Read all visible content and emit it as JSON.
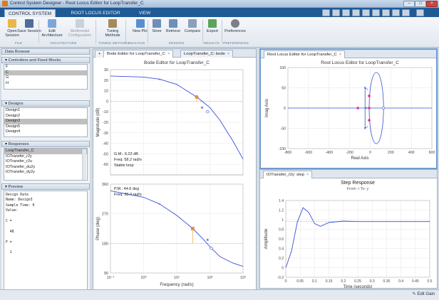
{
  "window": {
    "title": "Control System Designer - Root Locus Editor for LoopTransfer_C"
  },
  "tabs": [
    "CONTROL SYSTEM",
    "ROOT LOCUS EDITOR",
    "VIEW"
  ],
  "ribbon": {
    "buttons": [
      "Open Session",
      "Save Session",
      "Edit Architecture",
      "Multimodel Configuration",
      "Tuning Methods",
      "New Plot",
      "Store",
      "Retrieve",
      "Compare",
      "Export",
      "Preferences"
    ],
    "sections": [
      "FILE",
      "ARCHITECTURE",
      "TUNING METHODS",
      "ANALYSIS",
      "DESIGNS",
      "RESULTS",
      "PREFERENCES"
    ]
  },
  "data_browser": {
    "title": "Data Browser",
    "controllers_title": "Controllers and Fixed Blocks",
    "controllers": [
      "F",
      "C",
      "G",
      "H"
    ],
    "controllers_selected": 1,
    "designs_title": "Designs",
    "designs": [
      "Design1",
      "Design2",
      "Design3",
      "Design5",
      "Design4"
    ],
    "designs_selected": 2,
    "responses_title": "Responses",
    "responses": [
      "LoopTransfer_C",
      "IOTransfer_r2y",
      "IOTransfer_r2u",
      "IOTransfer_du2y",
      "IOTransfer_dy2y"
    ],
    "responses_selected": 0,
    "preview_title": "Preview",
    "preview_text": "Design Data\nName: Design3\nSample Time: 0\nValue:\n\nC =\n\n  48\n\nF =\n\n  1"
  },
  "bode_tabs": [
    "Bode Editor for LoopTransfer_C",
    "LoopTransfer_C: bode"
  ],
  "rl_tabs": [
    "Root Locus Editor for LoopTransfer_C"
  ],
  "step_tabs": [
    "IOTransfer_r2y: step"
  ],
  "status": {
    "edit_gain": "Edit Gain"
  },
  "chart_data": [
    {
      "type": "line",
      "title": "Bode Editor for LoopTransfer_C",
      "ylabel": "Magnitude (dB)",
      "xscale": "log",
      "xlim": [
        0.1,
        1000
      ],
      "ylim": [
        -70,
        30
      ],
      "x": [
        0.1,
        1,
        3,
        10,
        20,
        40,
        58.2,
        100,
        200,
        500,
        1000
      ],
      "y": [
        24,
        23,
        21,
        16,
        10,
        4,
        0,
        -6,
        -18,
        -38,
        -55
      ],
      "annotations": [
        "G.M.: 6.22 dB",
        "Freq: 58.2 rad/s",
        "Stable loop"
      ],
      "grid": true
    },
    {
      "type": "line",
      "ylabel": "Phase (deg)",
      "xlabel": "Frequency (rad/s)",
      "xscale": "log",
      "xlim": [
        0.1,
        1000
      ],
      "ylim": [
        90,
        360
      ],
      "x": [
        0.1,
        1,
        3,
        10,
        30.4,
        60,
        100,
        200,
        500,
        1000
      ],
      "y": [
        340,
        320,
        300,
        265,
        225,
        195,
        170,
        140,
        120,
        110
      ],
      "annotations": [
        "P.M.: 44.6 deg",
        "Freq: 30.4 rad/s"
      ],
      "grid": true
    },
    {
      "type": "scatter",
      "title": "Root Locus Editor for LoopTransfer_C",
      "xlabel": "Real Axis",
      "ylabel": "Imag Axis",
      "xlim": [
        -800,
        600
      ],
      "ylim": [
        -100,
        100
      ],
      "grid": true
    },
    {
      "type": "line",
      "title": "Step Response",
      "subtitle": "From: r  To: y",
      "xlabel": "Time (seconds)",
      "ylabel": "Amplitude",
      "xlim": [
        0,
        0.5
      ],
      "ylim": [
        -0.2,
        1.4
      ],
      "x": [
        0,
        0.02,
        0.04,
        0.06,
        0.08,
        0.1,
        0.12,
        0.15,
        0.2,
        0.25,
        0.3,
        0.4,
        0.5
      ],
      "y": [
        0,
        0.35,
        0.95,
        1.25,
        1.15,
        0.92,
        0.86,
        0.94,
        0.97,
        0.96,
        0.96,
        0.96,
        0.96
      ],
      "grid": true
    }
  ]
}
